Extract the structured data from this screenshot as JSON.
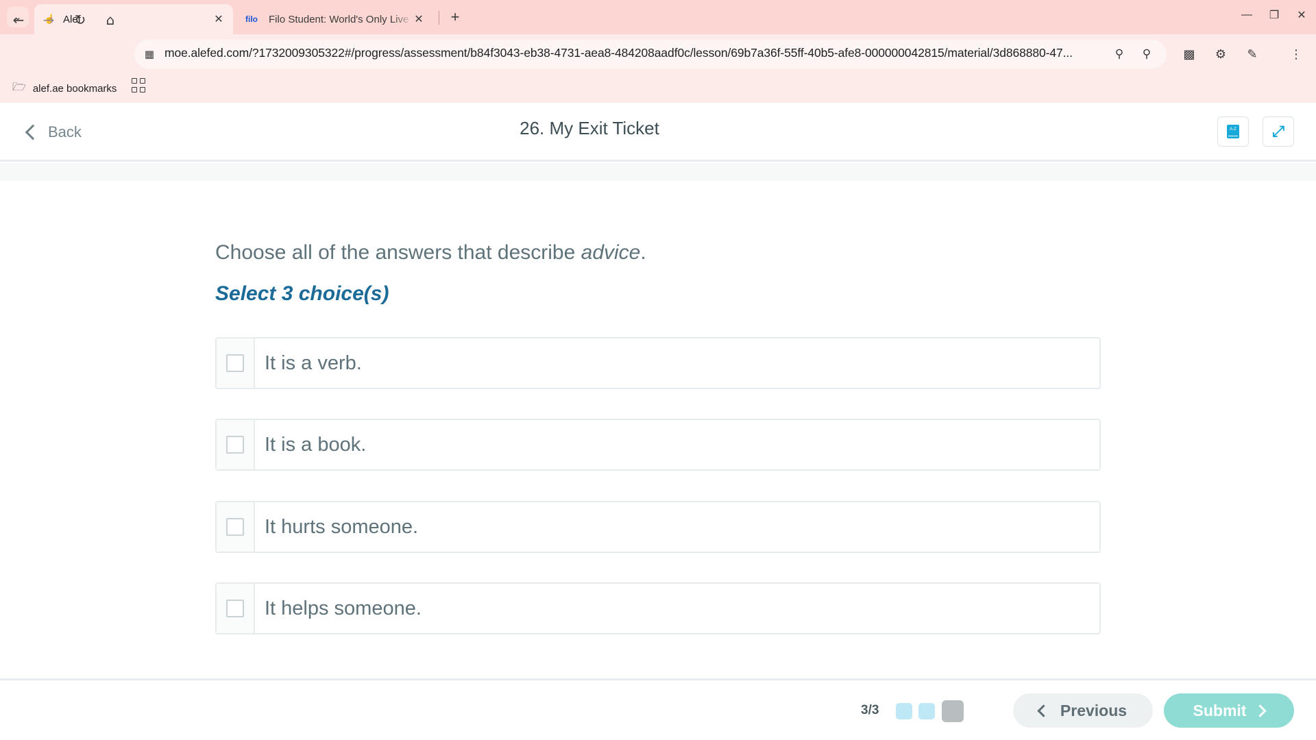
{
  "browser": {
    "tabs": [
      {
        "title": "Alef",
        "active": true
      },
      {
        "title": "Filo Student: World's Only Live Instant Tutoring Platform",
        "favicon_text": "filo",
        "active": false
      }
    ],
    "url": "moe.alefed.com/?1732009305322#/progress/assessment/b84f3043-eb38-4731-aea8-484208aadf0c/lesson/69b7a36f-55ff-40b5-afe8-000000042815/material/3d868880-47...",
    "bookmarks": {
      "folder_label": "alef.ae bookmarks"
    }
  },
  "header": {
    "back_label": "Back",
    "title": "26. My Exit Ticket",
    "glossary_icon_text": "A-Z"
  },
  "question": {
    "prompt_prefix": "Choose all of the answers that describe ",
    "prompt_emphasis": "advice",
    "prompt_suffix": ".",
    "instruction": "Select 3 choice(s)",
    "choices": [
      {
        "label": "It is a verb.",
        "checked": false
      },
      {
        "label": "It is a book.",
        "checked": false
      },
      {
        "label": "It hurts someone.",
        "checked": false
      },
      {
        "label": "It helps someone.",
        "checked": false
      }
    ]
  },
  "footer": {
    "progress_text": "3/3",
    "progress_steps": [
      "done",
      "done",
      "current"
    ],
    "previous_label": "Previous",
    "submit_label": "Submit"
  },
  "colors": {
    "accent": "#18a9d8",
    "instruction": "#1b6a98",
    "submit": "#8fdcd4",
    "browser_frame": "#fbd6d2"
  }
}
